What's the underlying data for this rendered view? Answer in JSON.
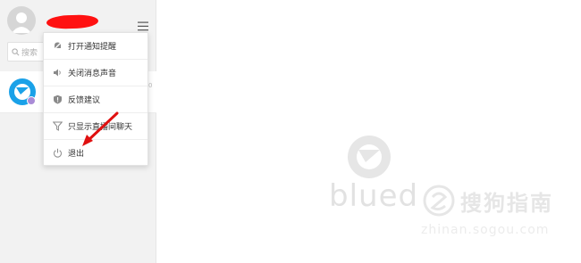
{
  "header": {
    "menu_icon": "hamburger-icon"
  },
  "search": {
    "placeholder": "搜索"
  },
  "conversation": {
    "time": "0"
  },
  "menu": {
    "items": [
      {
        "label": "打开通知提醒",
        "icon": "notification-bell-icon"
      },
      {
        "label": "关闭消息声音",
        "icon": "speaker-icon"
      },
      {
        "label": "反馈建议",
        "icon": "feedback-shield-icon"
      },
      {
        "label": "只显示直播间聊天",
        "icon": "filter-funnel-icon"
      },
      {
        "label": "退出",
        "icon": "power-icon"
      }
    ]
  },
  "main": {
    "brand": "blued"
  },
  "watermark": {
    "text": "搜狗指南",
    "url": "zhinan.sogou.com"
  },
  "colors": {
    "sidebar_bg": "#f2f2f2",
    "redaction": "#ff1111",
    "brand_blue": "#1aa1e8",
    "arrow": "#e01010"
  }
}
